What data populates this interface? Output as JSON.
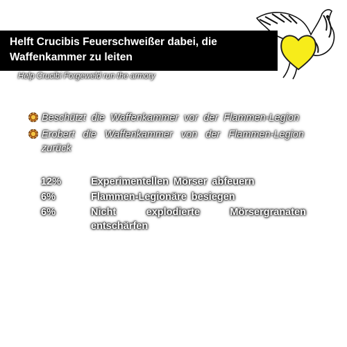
{
  "quest": {
    "title": "Helft Crucibis Feuerschweißer dabei, die Waffenkammer zu leiten",
    "subtitle": "Help Crucibi Forgeweld run the armory"
  },
  "objectives": [
    {
      "icon": "sun-medallion-icon",
      "text": "Beschützt die Waffenkammer vor der Flammen-Legion"
    },
    {
      "icon": "sun-medallion-icon",
      "text": "Erobert die Waffenkammer von der Flammen-Legion zurück"
    }
  ],
  "tasks": [
    {
      "percent": "12%",
      "label": "Experimentellen Mörser abfeuern"
    },
    {
      "percent": "6%",
      "label": "Flammen-Legionäre besiegen"
    },
    {
      "percent": "6%",
      "label": "Nicht explodierte Mörsergranaten entschärfen"
    }
  ],
  "emblem": {
    "icon": "eagle-with-heart-icon",
    "heart_color": "#f7ec1a"
  }
}
